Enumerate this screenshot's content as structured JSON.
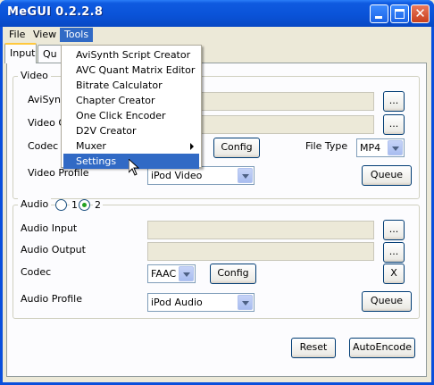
{
  "window": {
    "title": "MeGUI 0.2.2.8"
  },
  "menubar": {
    "items": [
      "File",
      "View",
      "Tools"
    ]
  },
  "tabs": [
    "Input",
    "Qu"
  ],
  "tools_menu": {
    "items": [
      {
        "label": "AviSynth Script Creator"
      },
      {
        "label": "AVC Quant Matrix Editor"
      },
      {
        "label": "Bitrate Calculator"
      },
      {
        "label": "Chapter Creator"
      },
      {
        "label": "One Click Encoder"
      },
      {
        "label": "D2V Creator"
      },
      {
        "label": "Muxer"
      },
      {
        "label": "Settings"
      }
    ],
    "highlighted": "Settings"
  },
  "video": {
    "group_label": "Video",
    "avisynth_label": "AviSyn",
    "output_label": "Video O",
    "codec_label": "Codec",
    "profile_label": "Video Profile",
    "browse_label": "...",
    "config_label": "Config",
    "filetype_label": "File Type",
    "filetype_value": "MP4",
    "profile_value": "iPod Video",
    "queue_label": "Queue"
  },
  "audio": {
    "group_label": "Audio",
    "radio1_label": "1",
    "radio2_label": "2",
    "input_label": "Audio Input",
    "output_label": "Audio Output",
    "codec_label": "Codec",
    "profile_label": "Audio Profile",
    "browse_label": "...",
    "codec_value": "FAAC",
    "config_label": "Config",
    "clear_label": "X",
    "profile_value": "iPod Audio",
    "queue_label": "Queue"
  },
  "footer": {
    "reset_label": "Reset",
    "autoencode_label": "AutoEncode"
  },
  "colors": {
    "titlebar": "#0a53d8",
    "menu_highlight": "#316ac5",
    "face": "#ece9d8"
  }
}
